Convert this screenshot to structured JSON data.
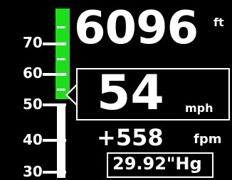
{
  "speed_tape": {
    "labels": [
      "70",
      "60",
      "50",
      "40",
      "30"
    ],
    "current_speed": 54
  },
  "altitude": {
    "value": "6096",
    "unit": "ft"
  },
  "airspeed": {
    "value": "54",
    "unit": "mph"
  },
  "vertical_speed": {
    "value": "+558",
    "unit": "fpm"
  },
  "barometer": {
    "value": "29.92\"Hg"
  },
  "colors": {
    "tape_green": "#19e019",
    "background": "#000000",
    "foreground": "#ffffff"
  }
}
